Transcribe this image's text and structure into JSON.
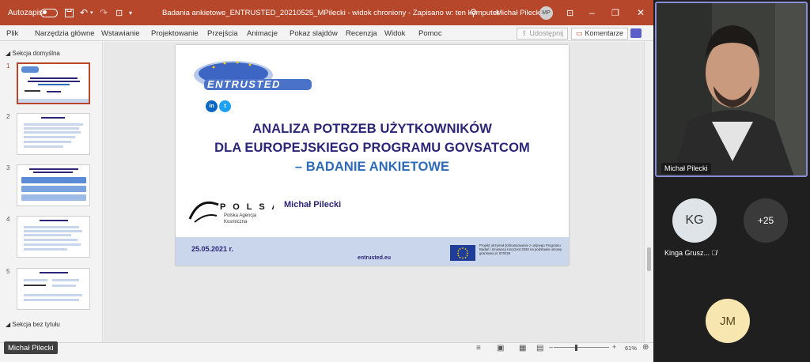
{
  "titlebar": {
    "autosave_label": "Autozapis",
    "document_title": "Badania ankietowe_ENTRUSTED_20210525_MPilecki",
    "separator1": "-",
    "protected_view": "widok chroniony",
    "separator2": "-",
    "saved_status": "Zapisano w: ten komputer",
    "user_name": "Michał Pilecki",
    "user_initials": "MP"
  },
  "ribbon": {
    "tabs": [
      "Plik",
      "Narzędzia główne",
      "Wstawianie",
      "Projektowanie",
      "Przejścia",
      "Animacje",
      "Pokaz slajdów",
      "Recenzja",
      "Widok",
      "Pomoc"
    ],
    "share_label": "Udostępnij",
    "comments_label": "Komentarze"
  },
  "thumbnails": {
    "section_default": "Sekcja domyślna",
    "section_untitled": "Sekcja bez tytułu",
    "slides": [
      {
        "number": "1",
        "title": "ANALIZA POTRZEB UŻYTKOWNIKÓW"
      },
      {
        "number": "2",
        "title": "CELE BADANIA"
      },
      {
        "number": "3",
        "title": "UŻYTKOWNICY PROGRAMU GOVSATCOM"
      },
      {
        "number": "4",
        "title": "BADANIE ANKIETOWE"
      },
      {
        "number": "5",
        "title": "PUNKT KONTAKTOWY"
      }
    ]
  },
  "slide": {
    "logo_text": "ENTRUSTED",
    "linkedin": "in",
    "twitter": "t",
    "title_line1": "ANALIZA POTRZEB UŻYTKOWNIKÓW",
    "title_line2": "DLA EUROPEJSKIEGO PROGRAMU GOVSATCOM",
    "title_line3": "– BADANIE ANKIETOWE",
    "polsa_logo": "P O L S A",
    "polsa_name1": "Polska Agencja",
    "polsa_name2": "Kosmiczna",
    "author": "Michał Pilecki",
    "date": "25.05.2021 r.",
    "url": "entrusted.eu",
    "eu_funding_text": "Projekt otrzymał dofinansowanie z unijnego Programu Badań i Innowacji Horyzont 2020 na podstawie umowy grantowej nr 870336"
  },
  "status": {
    "zoom": "61%",
    "presenter_name": "Michał Pilecki"
  },
  "teams": {
    "video_name": "Michał Pilecki",
    "participants": [
      {
        "initials": "KG",
        "label": "Kinga Grusz..."
      },
      {
        "initials": "+25"
      },
      {
        "initials": "JM"
      }
    ]
  },
  "colors": {
    "ppt_accent": "#b7472a",
    "title_navy": "#2b2677",
    "title_blue": "#2e6bb7",
    "teams_active": "#8a8eda"
  }
}
